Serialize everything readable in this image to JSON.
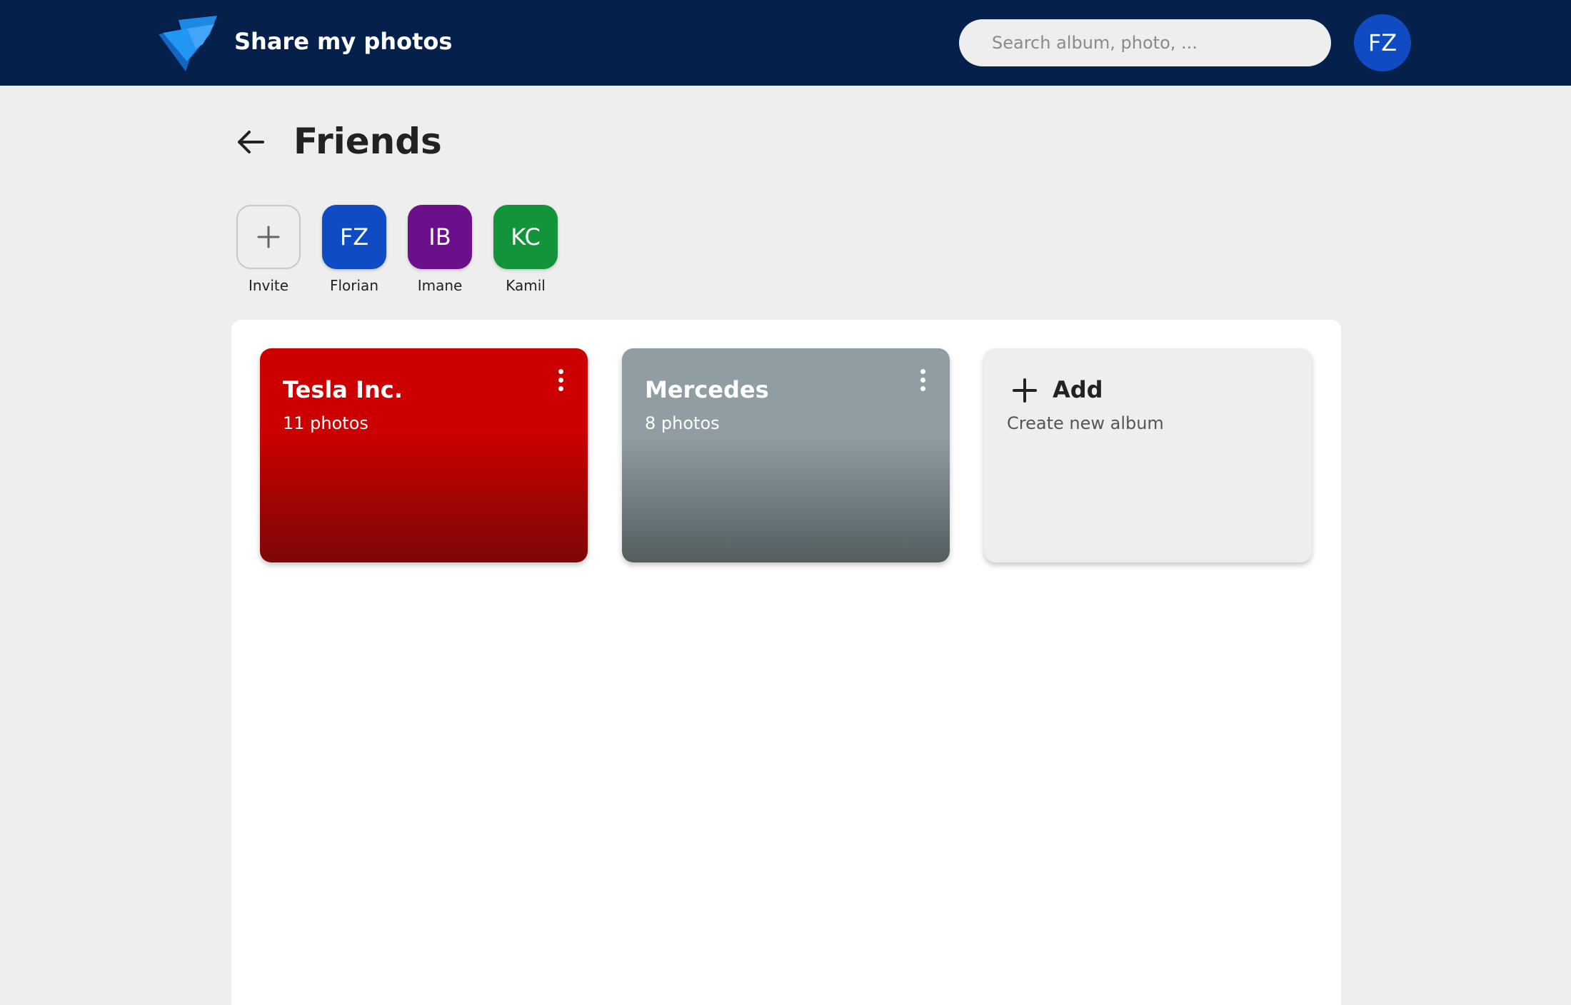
{
  "header": {
    "app_title": "Share my photos",
    "search_placeholder": "Search album, photo, ...",
    "user_initials": "FZ",
    "colors": {
      "background": "#05214b",
      "avatar": "#0f4cc4",
      "logo": "#1a73e8"
    }
  },
  "page": {
    "title": "Friends",
    "back_icon": "arrow-left-icon"
  },
  "members": {
    "invite": {
      "label": "Invite",
      "icon": "plus-icon"
    },
    "people": [
      {
        "initials": "FZ",
        "name": "Florian",
        "color": "#0f4cc4"
      },
      {
        "initials": "IB",
        "name": "Imane",
        "color": "#6c0f8a"
      },
      {
        "initials": "KC",
        "name": "Kamil",
        "color": "#14943a"
      }
    ]
  },
  "albums": [
    {
      "name": "Tesla Inc.",
      "count": "11 photos",
      "colors": [
        "#cc0000",
        "#7e0707"
      ],
      "menu_icon": "more-vertical-icon"
    },
    {
      "name": "Mercedes",
      "count": "8 photos",
      "colors": [
        "#909ea4",
        "#535d60"
      ],
      "menu_icon": "more-vertical-icon"
    }
  ],
  "add_album": {
    "label": "Add",
    "subtitle": "Create new album",
    "icon": "plus-icon"
  }
}
